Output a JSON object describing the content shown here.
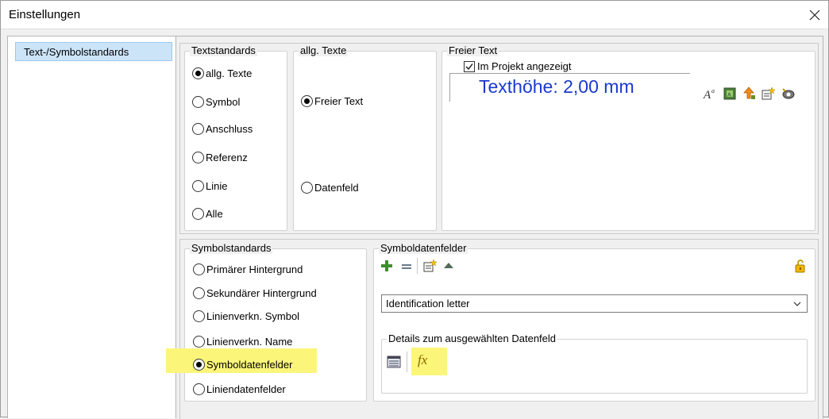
{
  "window": {
    "title": "Einstellungen"
  },
  "sidebar": {
    "items": [
      {
        "label": "Text-/Symbolstandards",
        "selected": true
      }
    ]
  },
  "textstandards": {
    "legend": "Textstandards",
    "options": [
      {
        "label": "allg. Texte",
        "checked": true
      },
      {
        "label": "Symbol",
        "checked": false
      },
      {
        "label": "Anschluss",
        "checked": false
      },
      {
        "label": "Referenz",
        "checked": false
      },
      {
        "label": "Linie",
        "checked": false
      },
      {
        "label": "Alle",
        "checked": false
      }
    ]
  },
  "allg_texte": {
    "legend": "allg. Texte",
    "options": [
      {
        "label": "Freier Text",
        "checked": true
      },
      {
        "label": "Datenfeld",
        "checked": false
      }
    ]
  },
  "freier_text": {
    "legend": "Freier Text",
    "checkbox_label": "Im Projekt angezeigt",
    "checkbox_checked": true,
    "preview_text": "Texthöhe: 2,00 mm",
    "preview_color": "#1a39d0",
    "tools": [
      "text-height-icon",
      "book-icon",
      "move-icon",
      "new-field-icon",
      "visibility-icon"
    ]
  },
  "symbolstandards": {
    "legend": "Symbolstandards",
    "options": [
      {
        "label": "Primärer Hintergrund",
        "checked": false
      },
      {
        "label": "Sekundärer Hintergrund",
        "checked": false
      },
      {
        "label": "Linienverkn. Symbol",
        "checked": false
      },
      {
        "label": "Linienverkn. Name",
        "checked": false
      },
      {
        "label": "Symboldatenfelder",
        "checked": true,
        "highlighted": true
      },
      {
        "label": "Liniendatenfelder",
        "checked": false
      }
    ]
  },
  "symboldatenfelder": {
    "legend": "Symboldatenfelder",
    "toolbar": [
      "add-icon",
      "remove-icon",
      "new-field-icon",
      "move-up-icon",
      "lock-icon"
    ],
    "selected_field": "Identification letter",
    "details": {
      "legend": "Details zum ausgewählten Datenfeld",
      "tools": [
        "table-icon",
        "formula-icon"
      ],
      "formula_label": "fx",
      "formula_highlighted": true
    }
  },
  "colors": {
    "highlight": "#fbf67a",
    "selection": "#cce4f7",
    "accent_text": "#1a39d0"
  }
}
